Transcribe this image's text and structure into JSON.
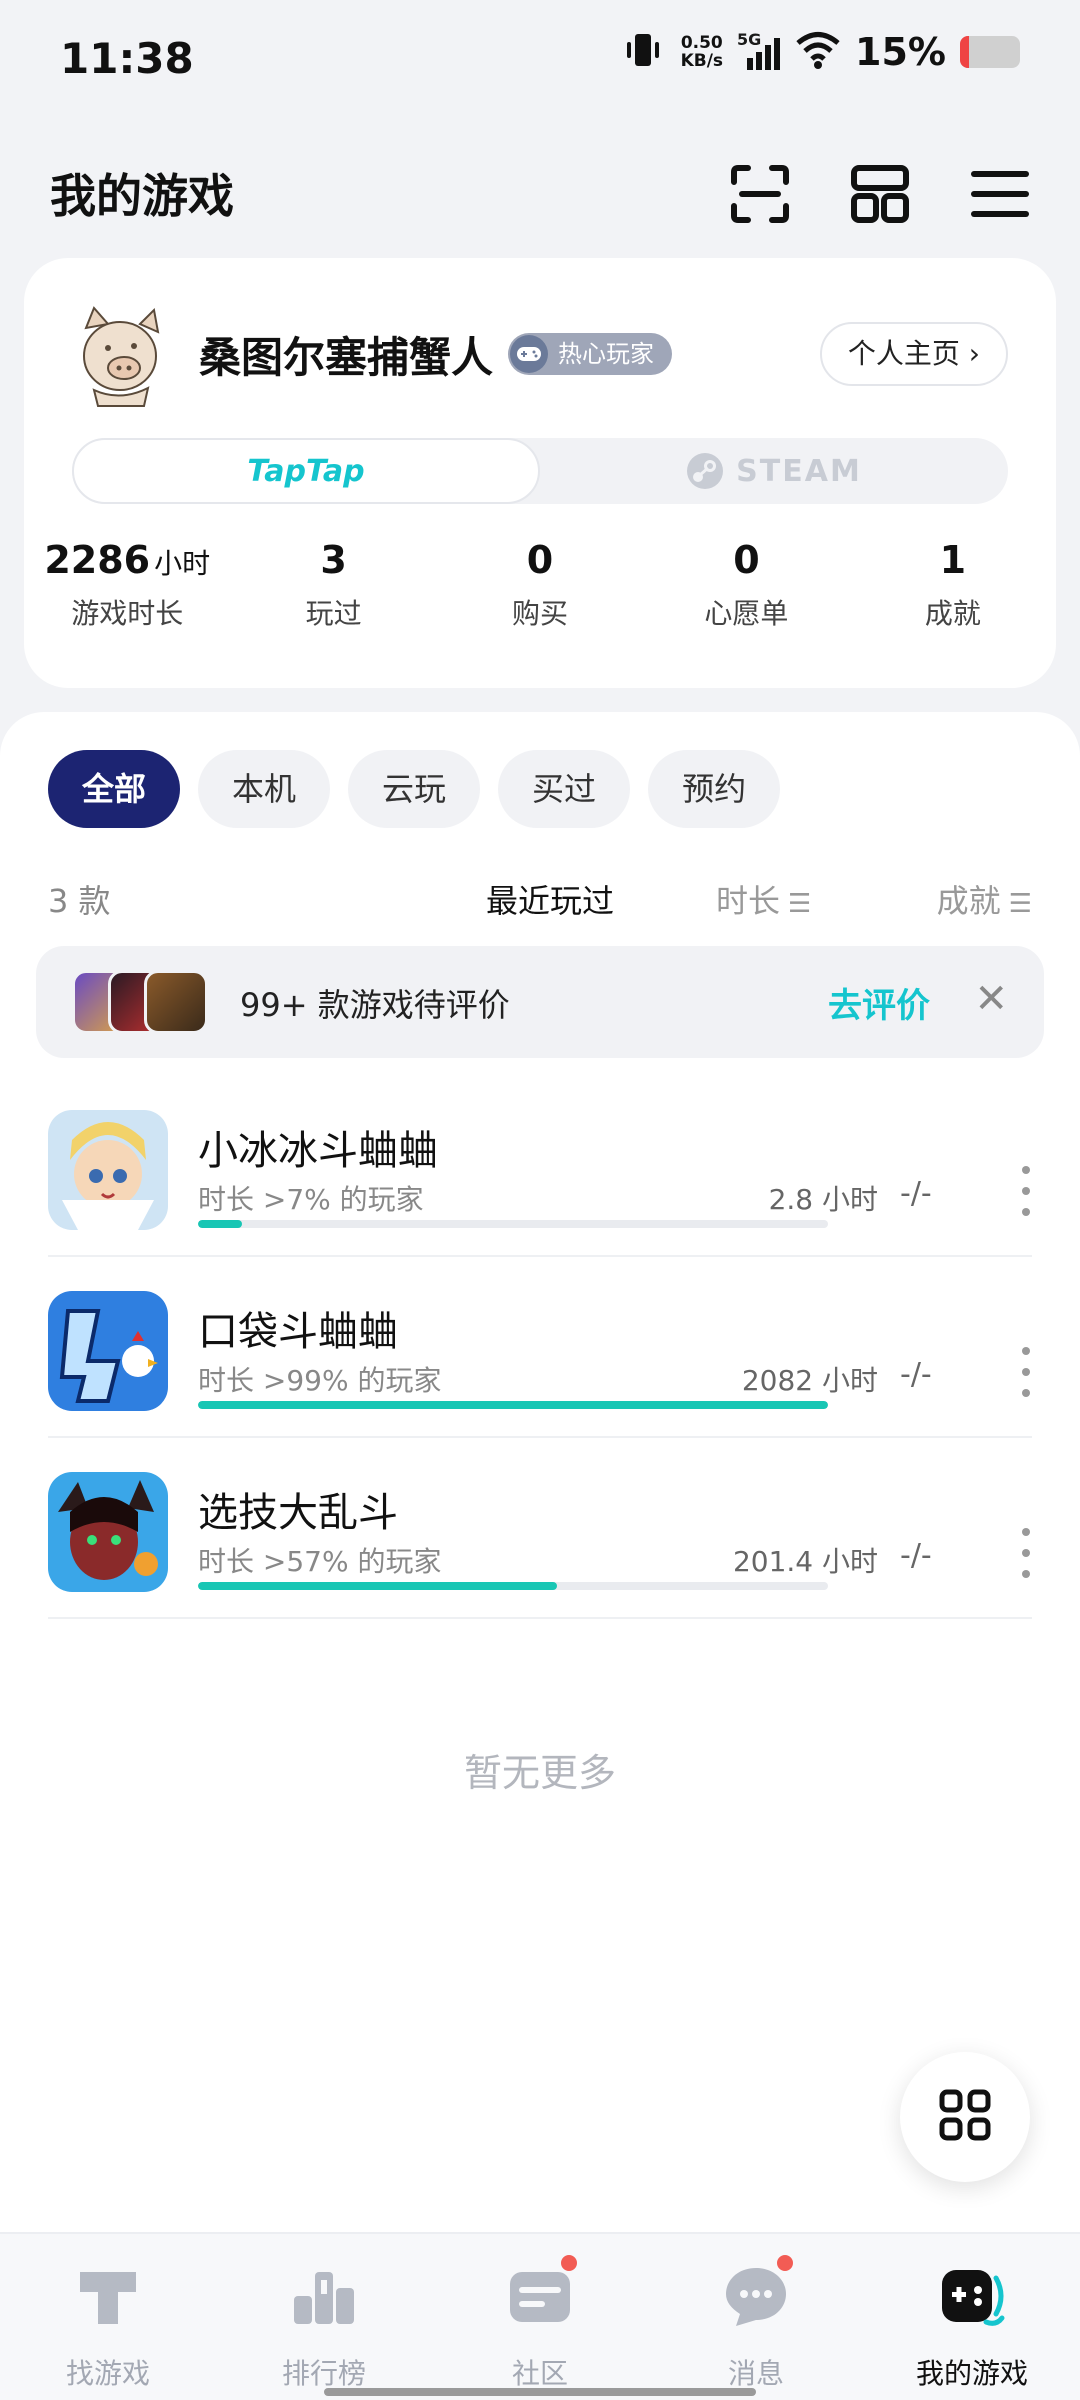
{
  "status_bar": {
    "time": "11:38",
    "net_speed_value": "0.50",
    "net_speed_unit": "KB/s",
    "network_type": "5G",
    "battery_percent": "15%",
    "battery_level": 0.15,
    "battery_color": "#ef4444"
  },
  "header": {
    "title": "我的游戏",
    "icons": [
      "scan-icon",
      "layout-grid-icon",
      "menu-icon"
    ]
  },
  "profile": {
    "username": "桑图尔塞捕蟹人",
    "badge": "热心玩家",
    "homepage_button": "个人主页 ›",
    "platforms": {
      "active": "TapTap",
      "inactive": "STEAM"
    },
    "stats": [
      {
        "value": "2286",
        "unit": "小时",
        "label": "游戏时长"
      },
      {
        "value": "3",
        "unit": "",
        "label": "玩过"
      },
      {
        "value": "0",
        "unit": "",
        "label": "购买"
      },
      {
        "value": "0",
        "unit": "",
        "label": "心愿单"
      },
      {
        "value": "1",
        "unit": "",
        "label": "成就"
      }
    ]
  },
  "filters": {
    "chips": [
      "全部",
      "本机",
      "云玩",
      "买过",
      "预约"
    ],
    "active_index": 0
  },
  "sort": {
    "count": "3 款",
    "recent": "最近玩过",
    "duration": "时长",
    "achievements": "成就"
  },
  "review_banner": {
    "text": "99+ 款游戏待评价",
    "action": "去评价",
    "close": "✕"
  },
  "games": [
    {
      "name": "小冰冰斗蛐蛐",
      "rank": "时长 >7% 的玩家",
      "hours": "2.8 小时",
      "progress": 0.07,
      "achievement": "-/-"
    },
    {
      "name": "口袋斗蛐蛐",
      "rank": "时长 >99% 的玩家",
      "hours": "2082 小时",
      "progress": 1.0,
      "achievement": "-/-"
    },
    {
      "name": "选技大乱斗",
      "rank": "时长 >57% 的玩家",
      "hours": "201.4 小时",
      "progress": 0.57,
      "achievement": "-/-"
    }
  ],
  "no_more": "暂无更多",
  "bottom_nav": [
    {
      "label": "找游戏",
      "icon": "taptap-icon",
      "active": false,
      "dot": false
    },
    {
      "label": "排行榜",
      "icon": "ranking-icon",
      "active": false,
      "dot": false
    },
    {
      "label": "社区",
      "icon": "community-icon",
      "active": false,
      "dot": true
    },
    {
      "label": "消息",
      "icon": "message-icon",
      "active": false,
      "dot": true
    },
    {
      "label": "我的游戏",
      "icon": "gamepad-icon",
      "active": true,
      "dot": false
    }
  ],
  "colors": {
    "accent": "#15c5ce",
    "progress": "#18c6b4",
    "chip_active": "#1c2472",
    "notification": "#f25c54"
  }
}
